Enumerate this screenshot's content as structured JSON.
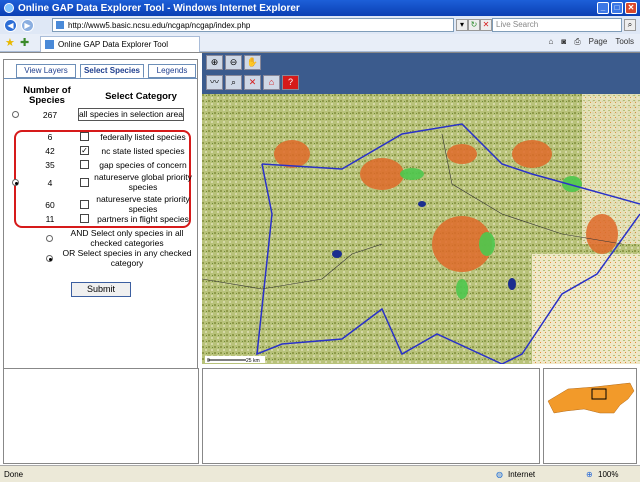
{
  "window": {
    "title": "Online GAP Data Explorer Tool - Windows Internet Explorer"
  },
  "address": {
    "url": "http://www5.basic.ncsu.edu/ncgap/ncgap/index.php",
    "search_placeholder": "Live Search"
  },
  "tab": {
    "label": "Online GAP Data Explorer Tool"
  },
  "toolbar": {
    "page": "Page",
    "tools": "Tools"
  },
  "panel": {
    "tabs": [
      "View Layers",
      "Select Species",
      "Legends"
    ],
    "header_number": "Number of Species",
    "header_category": "Select Category",
    "all": {
      "count": "267",
      "label": "all species in selection area"
    },
    "rows": [
      {
        "count": "6",
        "label": "federally listed species",
        "checked": false
      },
      {
        "count": "42",
        "label": "nc state listed species",
        "checked": true
      },
      {
        "count": "35",
        "label": "gap species of concern",
        "checked": false
      },
      {
        "count": "4",
        "label": "natureserve global priority species",
        "checked": false
      },
      {
        "count": "60",
        "label": "natureserve state priority species",
        "checked": false
      },
      {
        "count": "11",
        "label": "partners in flight species",
        "checked": false
      }
    ],
    "and_option": "AND Select only species in all checked categories",
    "or_option": "OR Select species in any checked category",
    "submit": "Submit"
  },
  "map": {
    "scale_start": "0",
    "scale_end": "25 km"
  },
  "status": {
    "left": "Done",
    "zone": "Internet",
    "zoom": "100%"
  }
}
